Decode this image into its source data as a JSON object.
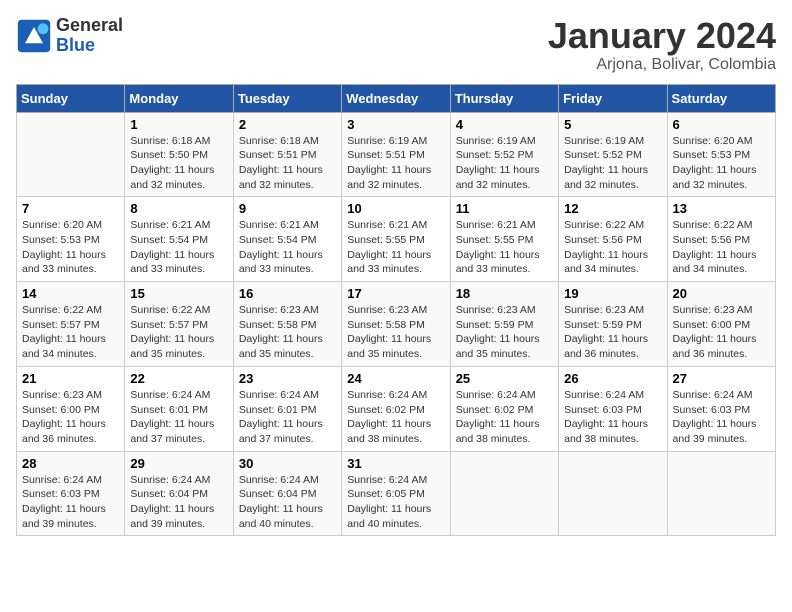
{
  "header": {
    "logo_general": "General",
    "logo_blue": "Blue",
    "month_title": "January 2024",
    "subtitle": "Arjona, Bolivar, Colombia"
  },
  "days_of_week": [
    "Sunday",
    "Monday",
    "Tuesday",
    "Wednesday",
    "Thursday",
    "Friday",
    "Saturday"
  ],
  "weeks": [
    [
      {
        "day": "",
        "info": ""
      },
      {
        "day": "1",
        "info": "Sunrise: 6:18 AM\nSunset: 5:50 PM\nDaylight: 11 hours\nand 32 minutes."
      },
      {
        "day": "2",
        "info": "Sunrise: 6:18 AM\nSunset: 5:51 PM\nDaylight: 11 hours\nand 32 minutes."
      },
      {
        "day": "3",
        "info": "Sunrise: 6:19 AM\nSunset: 5:51 PM\nDaylight: 11 hours\nand 32 minutes."
      },
      {
        "day": "4",
        "info": "Sunrise: 6:19 AM\nSunset: 5:52 PM\nDaylight: 11 hours\nand 32 minutes."
      },
      {
        "day": "5",
        "info": "Sunrise: 6:19 AM\nSunset: 5:52 PM\nDaylight: 11 hours\nand 32 minutes."
      },
      {
        "day": "6",
        "info": "Sunrise: 6:20 AM\nSunset: 5:53 PM\nDaylight: 11 hours\nand 32 minutes."
      }
    ],
    [
      {
        "day": "7",
        "info": "Sunrise: 6:20 AM\nSunset: 5:53 PM\nDaylight: 11 hours\nand 33 minutes."
      },
      {
        "day": "8",
        "info": "Sunrise: 6:21 AM\nSunset: 5:54 PM\nDaylight: 11 hours\nand 33 minutes."
      },
      {
        "day": "9",
        "info": "Sunrise: 6:21 AM\nSunset: 5:54 PM\nDaylight: 11 hours\nand 33 minutes."
      },
      {
        "day": "10",
        "info": "Sunrise: 6:21 AM\nSunset: 5:55 PM\nDaylight: 11 hours\nand 33 minutes."
      },
      {
        "day": "11",
        "info": "Sunrise: 6:21 AM\nSunset: 5:55 PM\nDaylight: 11 hours\nand 33 minutes."
      },
      {
        "day": "12",
        "info": "Sunrise: 6:22 AM\nSunset: 5:56 PM\nDaylight: 11 hours\nand 34 minutes."
      },
      {
        "day": "13",
        "info": "Sunrise: 6:22 AM\nSunset: 5:56 PM\nDaylight: 11 hours\nand 34 minutes."
      }
    ],
    [
      {
        "day": "14",
        "info": "Sunrise: 6:22 AM\nSunset: 5:57 PM\nDaylight: 11 hours\nand 34 minutes."
      },
      {
        "day": "15",
        "info": "Sunrise: 6:22 AM\nSunset: 5:57 PM\nDaylight: 11 hours\nand 35 minutes."
      },
      {
        "day": "16",
        "info": "Sunrise: 6:23 AM\nSunset: 5:58 PM\nDaylight: 11 hours\nand 35 minutes."
      },
      {
        "day": "17",
        "info": "Sunrise: 6:23 AM\nSunset: 5:58 PM\nDaylight: 11 hours\nand 35 minutes."
      },
      {
        "day": "18",
        "info": "Sunrise: 6:23 AM\nSunset: 5:59 PM\nDaylight: 11 hours\nand 35 minutes."
      },
      {
        "day": "19",
        "info": "Sunrise: 6:23 AM\nSunset: 5:59 PM\nDaylight: 11 hours\nand 36 minutes."
      },
      {
        "day": "20",
        "info": "Sunrise: 6:23 AM\nSunset: 6:00 PM\nDaylight: 11 hours\nand 36 minutes."
      }
    ],
    [
      {
        "day": "21",
        "info": "Sunrise: 6:23 AM\nSunset: 6:00 PM\nDaylight: 11 hours\nand 36 minutes."
      },
      {
        "day": "22",
        "info": "Sunrise: 6:24 AM\nSunset: 6:01 PM\nDaylight: 11 hours\nand 37 minutes."
      },
      {
        "day": "23",
        "info": "Sunrise: 6:24 AM\nSunset: 6:01 PM\nDaylight: 11 hours\nand 37 minutes."
      },
      {
        "day": "24",
        "info": "Sunrise: 6:24 AM\nSunset: 6:02 PM\nDaylight: 11 hours\nand 38 minutes."
      },
      {
        "day": "25",
        "info": "Sunrise: 6:24 AM\nSunset: 6:02 PM\nDaylight: 11 hours\nand 38 minutes."
      },
      {
        "day": "26",
        "info": "Sunrise: 6:24 AM\nSunset: 6:03 PM\nDaylight: 11 hours\nand 38 minutes."
      },
      {
        "day": "27",
        "info": "Sunrise: 6:24 AM\nSunset: 6:03 PM\nDaylight: 11 hours\nand 39 minutes."
      }
    ],
    [
      {
        "day": "28",
        "info": "Sunrise: 6:24 AM\nSunset: 6:03 PM\nDaylight: 11 hours\nand 39 minutes."
      },
      {
        "day": "29",
        "info": "Sunrise: 6:24 AM\nSunset: 6:04 PM\nDaylight: 11 hours\nand 39 minutes."
      },
      {
        "day": "30",
        "info": "Sunrise: 6:24 AM\nSunset: 6:04 PM\nDaylight: 11 hours\nand 40 minutes."
      },
      {
        "day": "31",
        "info": "Sunrise: 6:24 AM\nSunset: 6:05 PM\nDaylight: 11 hours\nand 40 minutes."
      },
      {
        "day": "",
        "info": ""
      },
      {
        "day": "",
        "info": ""
      },
      {
        "day": "",
        "info": ""
      }
    ]
  ]
}
